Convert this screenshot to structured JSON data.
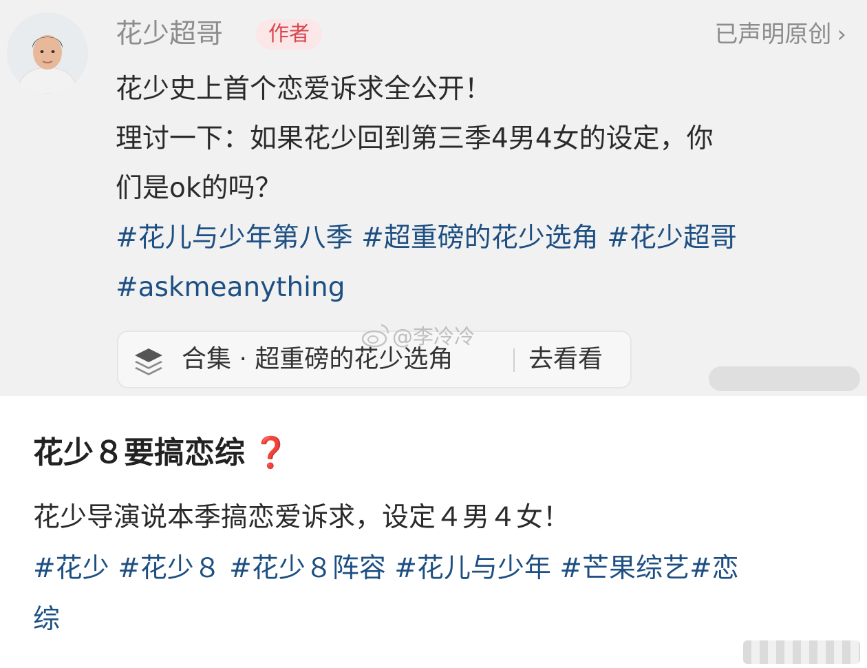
{
  "post": {
    "author_name": "花少超哥",
    "author_badge": "作者",
    "declared_original": "已声明原创",
    "lines": [
      "花少史上首个恋爱诉求全公开！",
      "理讨一下：如果花少回到第三季4男4女的设定，你",
      "们是ok的吗？"
    ],
    "tag_lines": [
      "#花儿与少年第八季 #超重磅的花少选角 #花少超哥",
      "#askmeanything"
    ],
    "collection_label": "合集 · 超重磅的花少选角",
    "collection_action": "去看看"
  },
  "watermark": {
    "text": "@李冷冷"
  },
  "section2": {
    "title": "花少８要搞恋综",
    "title_emoji": "❓",
    "body": "花少导演说本季搞恋爱诉求，设定４男４女！",
    "tag_lines": [
      "#花少 #花少８ #花少８阵容 #花儿与少年 #芒果综艺#恋",
      "综"
    ]
  },
  "colors": {
    "tag_blue": "#1d4f82",
    "badge_bg": "#fbe6e8",
    "badge_text": "#d9484f",
    "question_red": "#d31f1f"
  },
  "icons": [
    "user-avatar",
    "chevron-right-icon",
    "stack-layers-icon",
    "weibo-icon"
  ]
}
